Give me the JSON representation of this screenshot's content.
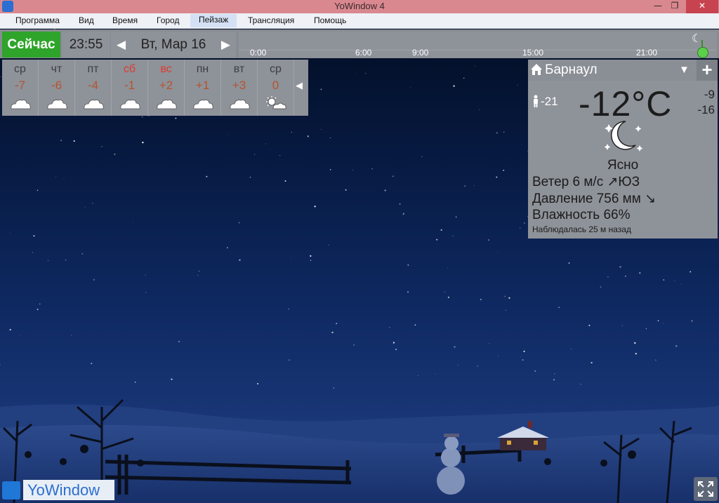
{
  "window": {
    "title": "YoWindow 4",
    "min": "—",
    "max": "❐",
    "close": "✕"
  },
  "menu": {
    "items": [
      "Программа",
      "Вид",
      "Время",
      "Город",
      "Пейзаж",
      "Трансляция",
      "Помощь"
    ]
  },
  "timebar": {
    "now_label": "Сейчас",
    "clock": "23:55",
    "date": "Вт, Мар 16",
    "prev_arrow": "◀",
    "next_arrow": "▶",
    "timeline_labels": [
      "0:00",
      "6:00",
      "9:00",
      "15:00",
      "21:00"
    ]
  },
  "forecast": {
    "days": [
      {
        "name": "ср",
        "temp": "-7",
        "weekend": false,
        "icon": "cloud-icon"
      },
      {
        "name": "чт",
        "temp": "-6",
        "weekend": false,
        "icon": "cloud-icon"
      },
      {
        "name": "пт",
        "temp": "-4",
        "weekend": false,
        "icon": "cloud-icon"
      },
      {
        "name": "сб",
        "temp": "-1",
        "weekend": true,
        "icon": "cloud-icon"
      },
      {
        "name": "вс",
        "temp": "+2",
        "weekend": true,
        "icon": "cloud-icon"
      },
      {
        "name": "пн",
        "temp": "+1",
        "weekend": false,
        "icon": "cloud-icon"
      },
      {
        "name": "вт",
        "temp": "+3",
        "weekend": false,
        "icon": "cloud-icon"
      },
      {
        "name": "ср",
        "temp": "0",
        "weekend": false,
        "icon": "sun-cloud-icon"
      }
    ],
    "collapse_arrow": "◀"
  },
  "panel": {
    "city": "Барнаул",
    "dropdown": "▼",
    "add": "+",
    "feels_like": "-21",
    "temperature": "-12°C",
    "high": "-9",
    "low": "-16",
    "condition": "Ясно",
    "wind": "Ветер  6 м/с ↗ЮЗ",
    "pressure": "Давление  756 мм ↘",
    "humidity": "Влажность  66%",
    "observed": "Наблюдалась 25 м назад"
  },
  "logo": {
    "text": "YoWindow"
  },
  "colors": {
    "now_green": "#2fa42a",
    "titlebar": "#d9888f",
    "weekend_red": "#e03a2d",
    "forecast_temp": "#b5542d"
  }
}
